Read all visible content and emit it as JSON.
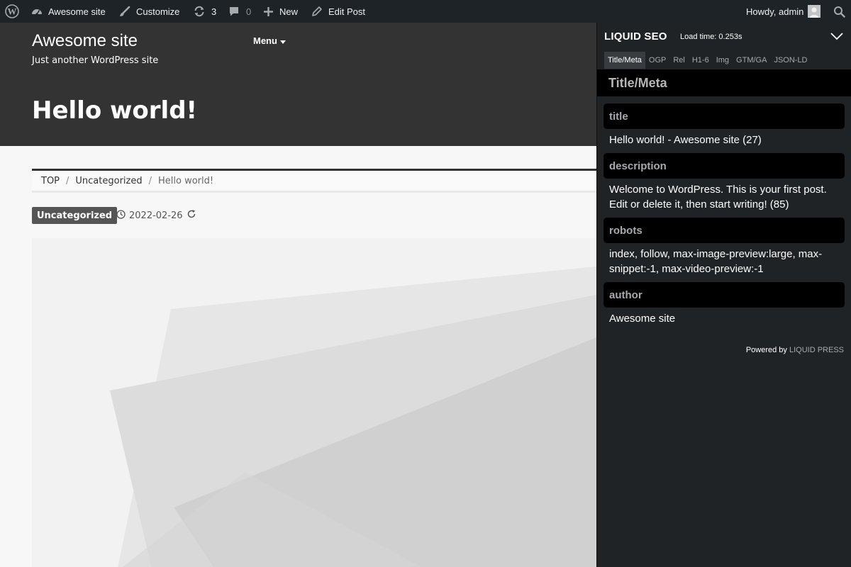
{
  "admin_bar": {
    "site_name": "Awesome site",
    "customize": "Customize",
    "updates_count": "3",
    "comments_count": "0",
    "new": "New",
    "edit_post": "Edit Post",
    "howdy": "Howdy, admin",
    "icons": [
      "wordpress-logo-icon",
      "dashboard-icon",
      "brush-icon",
      "updates-icon",
      "comment-icon",
      "plus-icon",
      "pencil-icon",
      "avatar-icon",
      "search-icon"
    ]
  },
  "site": {
    "title": "Awesome site",
    "tagline": "Just another WordPress site",
    "menu_label": "Menu"
  },
  "post": {
    "title": "Hello world!",
    "category": "Uncategorized",
    "date": "2022-02-26"
  },
  "breadcrumb": {
    "items": [
      "TOP",
      "Uncategorized",
      "Hello world!"
    ],
    "separator": "/"
  },
  "seo_panel": {
    "brand": "LIQUID SEO",
    "load_time": "Load time: 0.253s",
    "tabs": [
      "Title/Meta",
      "OGP",
      "Rel",
      "H1-6",
      "Img",
      "GTM/GA",
      "JSON-LD"
    ],
    "active_tab": "Title/Meta",
    "section_title": "Title/Meta",
    "fields": [
      {
        "label": "title",
        "value": "Hello world! - Awesome site (27)"
      },
      {
        "label": "description",
        "value": "Welcome to WordPress. This is your first post. Edit or delete it, then start writing! (85)"
      },
      {
        "label": "robots",
        "value": "index, follow, max-image-preview:large, max-snippet:-1, max-video-preview:-1"
      },
      {
        "label": "author",
        "value": "Awesome site"
      }
    ],
    "powered_by": "Powered by",
    "powered_brand": "LIQUID PRESS"
  },
  "colors": {
    "admin_bar_bg": "#1d2327",
    "header_bg": "#333333",
    "panel_bg": "#202326",
    "panel_label_bg": "#000000",
    "badge_bg": "#555555"
  }
}
